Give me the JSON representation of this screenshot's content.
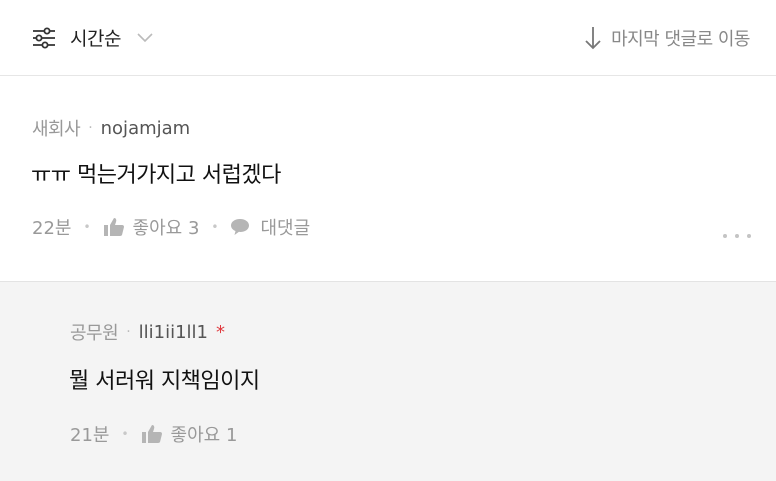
{
  "toolbar": {
    "sort_icon": "filter-sliders-icon",
    "sort_label": "시간순",
    "jump_label": "마지막 댓글로 이동",
    "jump_icon": "arrow-down-icon"
  },
  "comment": {
    "grade": "새회사",
    "nickname": "nojamjam",
    "text": "ㅠㅠ 먹는거가지고 서럽겠다",
    "time": "22분",
    "like_label": "좋아요 3",
    "reply_label": "대댓글",
    "more_icon": "more-dots-icon"
  },
  "reply": {
    "grade": "공무원",
    "nickname": "lli1ii1ll1",
    "author_mark": "*",
    "text": "뭘 서러워 지책임이지",
    "time": "21분",
    "like_label": "좋아요 1"
  },
  "colors": {
    "text_primary": "#111111",
    "text_muted": "#999999",
    "author_star": "#e0393e",
    "reply_bg": "#f4f4f4"
  }
}
